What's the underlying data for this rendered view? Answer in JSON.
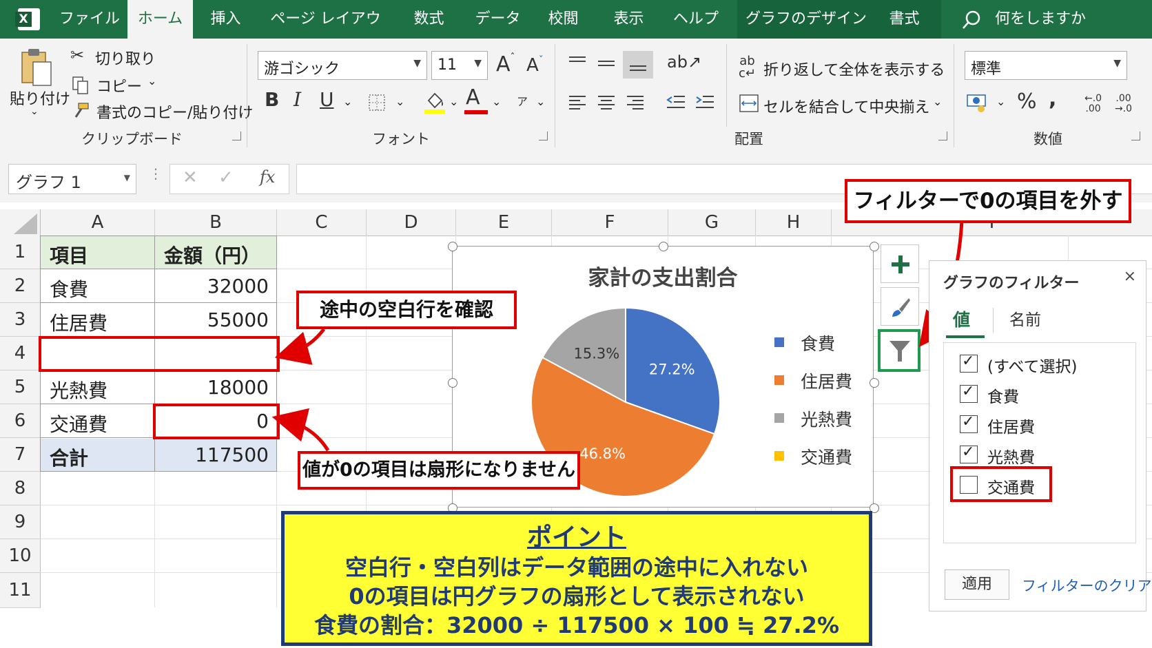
{
  "ribbon_tabs": {
    "file": "ファイル",
    "home": "ホーム",
    "insert": "挿入",
    "page_layout": "ページ レイアウト",
    "formulas": "数式",
    "data": "データ",
    "review": "校閲",
    "view": "表示",
    "help": "ヘルプ",
    "chart_design": "グラフのデザイン",
    "format": "書式",
    "tell_me": "何をしますか"
  },
  "clipboard": {
    "paste": "貼り付け",
    "cut": "切り取り",
    "copy": "コピー",
    "format_painter": "書式のコピー/貼り付け",
    "group": "クリップボード"
  },
  "font": {
    "name": "游ゴシック",
    "size": "11",
    "group": "フォント"
  },
  "alignment": {
    "wrap_text": "折り返して全体を表示する",
    "merge_center": "セルを結合して中央揃え",
    "group": "配置"
  },
  "number": {
    "format": "標準",
    "group": "数値"
  },
  "formula_bar": {
    "name_box": "グラフ 1",
    "fx": "fx"
  },
  "columns": [
    "A",
    "B",
    "C",
    "D",
    "E",
    "F",
    "G",
    "H",
    "I"
  ],
  "rows": [
    "1",
    "2",
    "3",
    "4",
    "5",
    "6",
    "7",
    "8",
    "9",
    "10",
    "11"
  ],
  "table": {
    "header": [
      "項目",
      "金額（円）"
    ],
    "rows": [
      [
        "食費",
        "32000"
      ],
      [
        "住居費",
        "55000"
      ],
      [
        "",
        ""
      ],
      [
        "光熱費",
        "18000"
      ],
      [
        "交通費",
        "0"
      ],
      [
        "合計",
        "117500"
      ]
    ]
  },
  "callouts": {
    "blank_row": "途中の空白行を確認",
    "zero_value": "値が0の項目は扇形になりません",
    "filter": "フィルターで0の項目を外す"
  },
  "chart_data": {
    "type": "pie",
    "title": "家計の支出割合",
    "categories": [
      "食費",
      "住居費",
      "光熱費",
      "交通費"
    ],
    "values": [
      32000,
      55000,
      18000,
      0
    ],
    "data_labels": [
      "27.2%",
      "46.8%",
      "15.3%",
      ""
    ],
    "colors": [
      "#4472c4",
      "#ed7d31",
      "#a5a5a5",
      "#ffc000"
    ],
    "legend_position": "right"
  },
  "point_box": {
    "title": "ポイント",
    "lines": [
      "空白行・空白列はデータ範囲の途中に入れない",
      "0の項目は円グラフの扇形として表示されない",
      "食費の割合：32000 ÷ 117500 × 100 ≒ 27.2%"
    ]
  },
  "filter_pane": {
    "title": "グラフのフィルター",
    "close": "×",
    "tab_values": "値",
    "tab_names": "名前",
    "items": [
      {
        "label": "(すべて選択)",
        "checked": true
      },
      {
        "label": "食費",
        "checked": true
      },
      {
        "label": "住居費",
        "checked": true
      },
      {
        "label": "光熱費",
        "checked": true
      },
      {
        "label": "交通費",
        "checked": false
      }
    ],
    "apply": "適用",
    "clear": "フィルターのクリア"
  },
  "side_buttons": {
    "plus": "+"
  },
  "colors": {
    "excel_green": "#1e7145",
    "header_fill": "#e2efda",
    "total_fill": "#dde6f2",
    "callout_red": "#e00000",
    "point_yellow": "#ffff33",
    "point_border": "#1f3a75"
  }
}
